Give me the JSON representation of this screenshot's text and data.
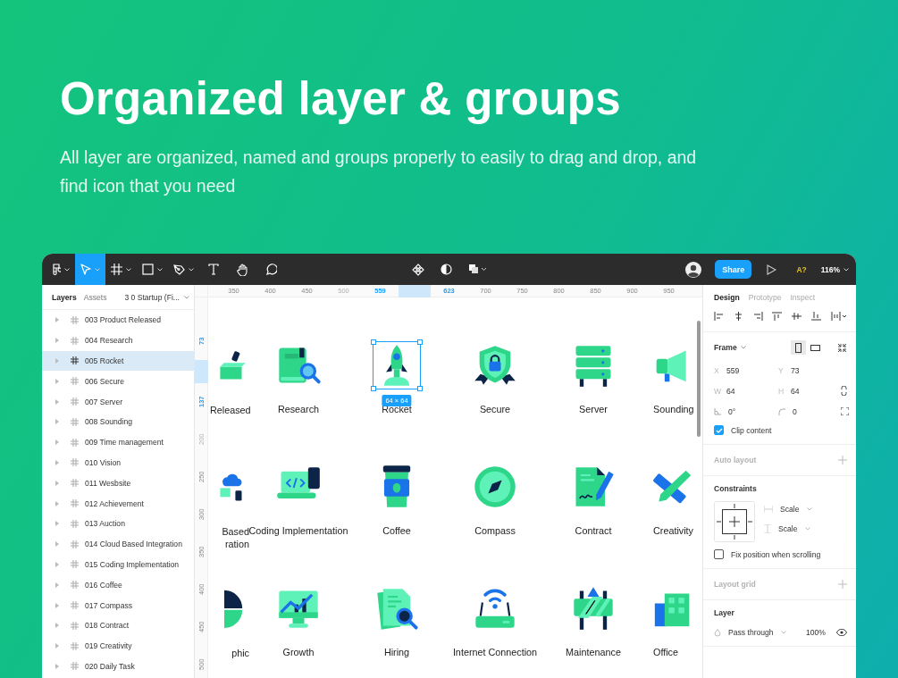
{
  "headline": "Organized layer & groups",
  "description": "All layer are organized, named and groups properly to easily to drag and drop, and find icon that you need",
  "toolbar": {
    "tools": [
      {
        "kind": "main-menu",
        "selected": false
      },
      {
        "kind": "move",
        "selected": true
      },
      {
        "kind": "frame",
        "selected": false
      },
      {
        "kind": "rectangle",
        "selected": false
      },
      {
        "kind": "pen",
        "selected": false
      },
      {
        "kind": "text",
        "selected": false
      },
      {
        "kind": "hand",
        "selected": false
      },
      {
        "kind": "comment",
        "selected": false
      }
    ],
    "actions": [
      {
        "kind": "component"
      },
      {
        "kind": "mask"
      },
      {
        "kind": "boolean"
      }
    ],
    "share": "Share",
    "font_warning": "A?",
    "zoom": "116%"
  },
  "left_panel": {
    "tabs": [
      {
        "label": "Layers",
        "selected": true
      },
      {
        "label": "Assets",
        "selected": false
      }
    ],
    "page": "3 0 Startup (Fi...",
    "layers": [
      {
        "name": "003 Product Released",
        "selected": false
      },
      {
        "name": "004 Research",
        "selected": false
      },
      {
        "name": "005 Rocket",
        "selected": true
      },
      {
        "name": "006 Secure",
        "selected": false
      },
      {
        "name": "007 Server",
        "selected": false
      },
      {
        "name": "008 Sounding",
        "selected": false
      },
      {
        "name": "009 Time management",
        "selected": false
      },
      {
        "name": "010 Vision",
        "selected": false
      },
      {
        "name": "011 Wesbsite",
        "selected": false
      },
      {
        "name": "012 Achievement",
        "selected": false
      },
      {
        "name": "013 Auction",
        "selected": false
      },
      {
        "name": "014 Cloud Based Integration",
        "selected": false
      },
      {
        "name": "015 Coding Implementation",
        "selected": false
      },
      {
        "name": "016 Coffee",
        "selected": false
      },
      {
        "name": "017 Compass",
        "selected": false
      },
      {
        "name": "018 Contract",
        "selected": false
      },
      {
        "name": "019 Creativity",
        "selected": false
      },
      {
        "name": "020 Daily Task",
        "selected": false
      }
    ]
  },
  "canvas": {
    "top_ruler": [
      {
        "label": "350",
        "kind": "normal"
      },
      {
        "label": "400",
        "kind": "normal"
      },
      {
        "label": "450",
        "kind": "normal"
      },
      {
        "label": "500",
        "kind": "faded"
      },
      {
        "label": "559",
        "kind": "selection"
      },
      {
        "label": "623",
        "kind": "selection"
      },
      {
        "label": "700",
        "kind": "normal"
      },
      {
        "label": "750",
        "kind": "normal"
      },
      {
        "label": "800",
        "kind": "normal"
      },
      {
        "label": "850",
        "kind": "normal"
      },
      {
        "label": "900",
        "kind": "normal"
      },
      {
        "label": "950",
        "kind": "normal"
      }
    ],
    "left_ruler": [
      {
        "label": "73",
        "kind": "selection"
      },
      {
        "label": "137",
        "kind": "selection"
      },
      {
        "label": "200",
        "kind": "faded"
      },
      {
        "label": "250",
        "kind": "normal"
      },
      {
        "label": "300",
        "kind": "normal"
      },
      {
        "label": "350",
        "kind": "normal"
      },
      {
        "label": "400",
        "kind": "normal"
      },
      {
        "label": "450",
        "kind": "normal"
      },
      {
        "label": "500",
        "kind": "normal"
      }
    ],
    "tiles": [
      {
        "label": "Released",
        "selected": false
      },
      {
        "label": "Research",
        "selected": false
      },
      {
        "label": "Rocket",
        "selected": true,
        "size": "64 × 64"
      },
      {
        "label": "Secure",
        "selected": false
      },
      {
        "label": "Server",
        "selected": false
      },
      {
        "label": "Sounding",
        "selected": false
      },
      {
        "label": "Based ration",
        "selected": false
      },
      {
        "label": "Coding Implementation",
        "selected": false
      },
      {
        "label": "Coffee",
        "selected": false
      },
      {
        "label": "Compass",
        "selected": false
      },
      {
        "label": "Contract",
        "selected": false
      },
      {
        "label": "Creativity",
        "selected": false
      },
      {
        "label": "phic",
        "selected": false
      },
      {
        "label": "Growth",
        "selected": false
      },
      {
        "label": "Hiring",
        "selected": false
      },
      {
        "label": "Internet Connection",
        "selected": false
      },
      {
        "label": "Maintenance",
        "selected": false
      },
      {
        "label": "Office",
        "selected": false
      }
    ]
  },
  "right_panel": {
    "tabs": [
      {
        "label": "Design",
        "selected": true
      },
      {
        "label": "Prototype",
        "selected": false
      },
      {
        "label": "Inspect",
        "selected": false
      }
    ],
    "frame": {
      "title": "Frame",
      "orientation": [
        {
          "kind": "portrait",
          "selected": true
        },
        {
          "kind": "landscape",
          "selected": false
        }
      ],
      "fields": [
        {
          "kind": "text",
          "label": "X",
          "value": "559"
        },
        {
          "kind": "text",
          "label": "Y",
          "value": "73"
        },
        {
          "kind": "text",
          "label": "W",
          "value": "64"
        },
        {
          "kind": "text",
          "label": "H",
          "value": "64"
        },
        {
          "kind": "rotation",
          "value": "0°"
        },
        {
          "kind": "radius",
          "value": "0"
        }
      ],
      "clip_content": {
        "label": "Clip content",
        "checked": true
      }
    },
    "auto_layout": "Auto layout",
    "constraints": {
      "title": "Constraints",
      "horizontal": "Scale",
      "vertical": "Scale",
      "fix_position": {
        "label": "Fix position when scrolling",
        "checked": false
      }
    },
    "layout_grid": "Layout grid",
    "layer": {
      "title": "Layer",
      "blend": "Pass through",
      "opacity": "100%"
    }
  }
}
